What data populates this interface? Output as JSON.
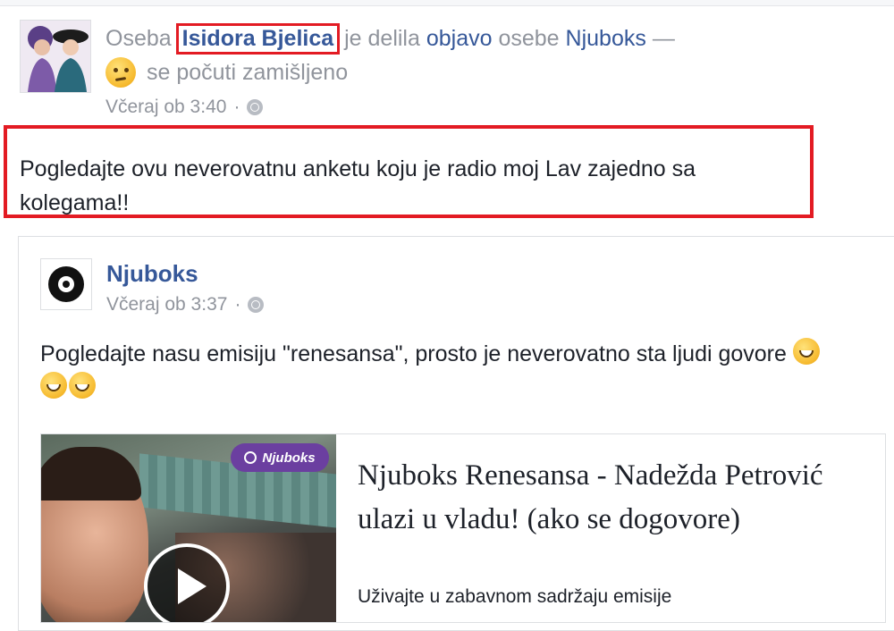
{
  "sharer": {
    "prefix": "Oseba",
    "name": "Isidora Bjelica",
    "verb": "je delila",
    "object_link": "objavo",
    "object_rest": "osebe",
    "page_name": "Njuboks",
    "dash": "—",
    "feeling": "se počuti zamišljeno",
    "feeling_icon": "thinking-face-emoji",
    "time": "Včeraj ob 3:40",
    "dot": "·",
    "privacy_icon": "globe-icon",
    "post_text": "Pogledajte ovu neverovatnu anketu koju je radio moj Lav zajedno sa kolegama!!"
  },
  "shared": {
    "page_name": "Njuboks",
    "time": "Včeraj ob 3:37",
    "dot": "·",
    "privacy_icon": "globe-icon",
    "text": "Pogledajte nasu emisiju \"renesansa\", prosto je neverovatno sta ljudi govore",
    "emojis": [
      "grinning-sweat-emoji",
      "grinning-sweat-emoji",
      "grinning-sweat-emoji"
    ],
    "link": {
      "badge": "Njuboks",
      "title": "Njuboks Renesansa - Nadežda Petrović ulazi u vladu! (ako se dogovore)",
      "description": "Uživajte u zabavnom sadržaju emisije"
    }
  },
  "colors": {
    "highlight": "#e31b23",
    "link": "#365899",
    "meta": "#90949c",
    "badge": "#6b3fa0"
  }
}
